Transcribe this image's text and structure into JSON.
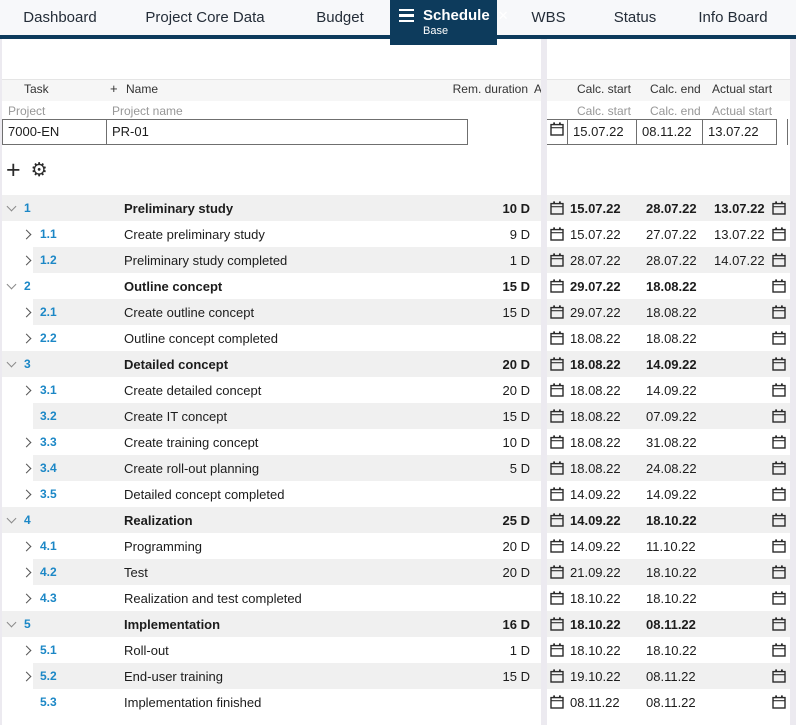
{
  "tabbar": {
    "tabs": [
      {
        "label": "Dashboard",
        "active": false
      },
      {
        "label": "Project Core Data",
        "active": false
      },
      {
        "label": "Budget",
        "active": false
      },
      {
        "label": "Schedule",
        "active": true,
        "sublabel": "Base"
      },
      {
        "label": "WBS",
        "active": false
      },
      {
        "label": "Status",
        "active": false
      },
      {
        "label": "Info Board",
        "active": false
      }
    ]
  },
  "icons": {
    "close_glyph": "✕",
    "plus_glyph": "+",
    "gear_glyph": "⚙",
    "names": [
      "hamburger-icon",
      "close-icon",
      "plus-icon",
      "gear-icon",
      "calendar-icon",
      "chevron-down-icon",
      "chevron-right-icon"
    ]
  },
  "colors": {
    "accent_navy": "#0d3b5c",
    "task_number_blue": "#1b87c6",
    "row_shade": "#f0f0f0",
    "splitter": "#eceaf0"
  },
  "table": {
    "left_headers": {
      "task": "Task",
      "add": "+",
      "name": "Name",
      "rem_duration": "Rem. duration",
      "a": "A"
    },
    "left_sub_headers": {
      "task": "Project",
      "name": "Project name"
    },
    "right_headers": {
      "calc_start": "Calc. start",
      "calc_end": "Calc. end",
      "actual_start": "Actual start"
    },
    "right_sub_headers": {
      "calc_start": "Calc. start",
      "calc_end": "Calc. end",
      "actual_start": "Actual start"
    },
    "project_row": {
      "task": "7000-EN",
      "name": "PR-01",
      "calc_start": "15.07.22",
      "calc_end": "08.11.22",
      "actual_start": "13.07.22"
    },
    "rows": [
      {
        "id": "1",
        "name": "Preliminary study",
        "duration": "10 D",
        "calc_start": "15.07.22",
        "calc_end": "28.07.22",
        "actual_start": "13.07.22",
        "group": true,
        "chevron": "down"
      },
      {
        "id": "1.1",
        "name": "Create preliminary study",
        "duration": "9 D",
        "calc_start": "15.07.22",
        "calc_end": "27.07.22",
        "actual_start": "13.07.22",
        "group": false,
        "chevron": "right"
      },
      {
        "id": "1.2",
        "name": "Preliminary study completed",
        "duration": "1 D",
        "calc_start": "28.07.22",
        "calc_end": "28.07.22",
        "actual_start": "14.07.22",
        "group": false,
        "chevron": "right"
      },
      {
        "id": "2",
        "name": "Outline concept",
        "duration": "15 D",
        "calc_start": "29.07.22",
        "calc_end": "18.08.22",
        "actual_start": "",
        "group": true,
        "chevron": "down"
      },
      {
        "id": "2.1",
        "name": "Create outline concept",
        "duration": "15 D",
        "calc_start": "29.07.22",
        "calc_end": "18.08.22",
        "actual_start": "",
        "group": false,
        "chevron": "right"
      },
      {
        "id": "2.2",
        "name": "Outline concept completed",
        "duration": "",
        "calc_start": "18.08.22",
        "calc_end": "18.08.22",
        "actual_start": "",
        "group": false,
        "chevron": "right"
      },
      {
        "id": "3",
        "name": "Detailed concept",
        "duration": "20 D",
        "calc_start": "18.08.22",
        "calc_end": "14.09.22",
        "actual_start": "",
        "group": true,
        "chevron": "down"
      },
      {
        "id": "3.1",
        "name": "Create detailed concept",
        "duration": "20 D",
        "calc_start": "18.08.22",
        "calc_end": "14.09.22",
        "actual_start": "",
        "group": false,
        "chevron": "right"
      },
      {
        "id": "3.2",
        "name": "Create IT concept",
        "duration": "15 D",
        "calc_start": "18.08.22",
        "calc_end": "07.09.22",
        "actual_start": "",
        "group": false,
        "chevron": "none"
      },
      {
        "id": "3.3",
        "name": "Create training concept",
        "duration": "10 D",
        "calc_start": "18.08.22",
        "calc_end": "31.08.22",
        "actual_start": "",
        "group": false,
        "chevron": "right"
      },
      {
        "id": "3.4",
        "name": "Create roll-out planning",
        "duration": "5 D",
        "calc_start": "18.08.22",
        "calc_end": "24.08.22",
        "actual_start": "",
        "group": false,
        "chevron": "right"
      },
      {
        "id": "3.5",
        "name": "Detailed concept completed",
        "duration": "",
        "calc_start": "14.09.22",
        "calc_end": "14.09.22",
        "actual_start": "",
        "group": false,
        "chevron": "right"
      },
      {
        "id": "4",
        "name": "Realization",
        "duration": "25 D",
        "calc_start": "14.09.22",
        "calc_end": "18.10.22",
        "actual_start": "",
        "group": true,
        "chevron": "down"
      },
      {
        "id": "4.1",
        "name": "Programming",
        "duration": "20 D",
        "calc_start": "14.09.22",
        "calc_end": "11.10.22",
        "actual_start": "",
        "group": false,
        "chevron": "right"
      },
      {
        "id": "4.2",
        "name": "Test",
        "duration": "20 D",
        "calc_start": "21.09.22",
        "calc_end": "18.10.22",
        "actual_start": "",
        "group": false,
        "chevron": "right"
      },
      {
        "id": "4.3",
        "name": "Realization and test completed",
        "duration": "",
        "calc_start": "18.10.22",
        "calc_end": "18.10.22",
        "actual_start": "",
        "group": false,
        "chevron": "right"
      },
      {
        "id": "5",
        "name": "Implementation",
        "duration": "16 D",
        "calc_start": "18.10.22",
        "calc_end": "08.11.22",
        "actual_start": "",
        "group": true,
        "chevron": "down"
      },
      {
        "id": "5.1",
        "name": "Roll-out",
        "duration": "1 D",
        "calc_start": "18.10.22",
        "calc_end": "18.10.22",
        "actual_start": "",
        "group": false,
        "chevron": "right"
      },
      {
        "id": "5.2",
        "name": "End-user training",
        "duration": "15 D",
        "calc_start": "19.10.22",
        "calc_end": "08.11.22",
        "actual_start": "",
        "group": false,
        "chevron": "right"
      },
      {
        "id": "5.3",
        "name": "Implementation finished",
        "duration": "",
        "calc_start": "08.11.22",
        "calc_end": "08.11.22",
        "actual_start": "",
        "group": false,
        "chevron": "none"
      }
    ]
  }
}
